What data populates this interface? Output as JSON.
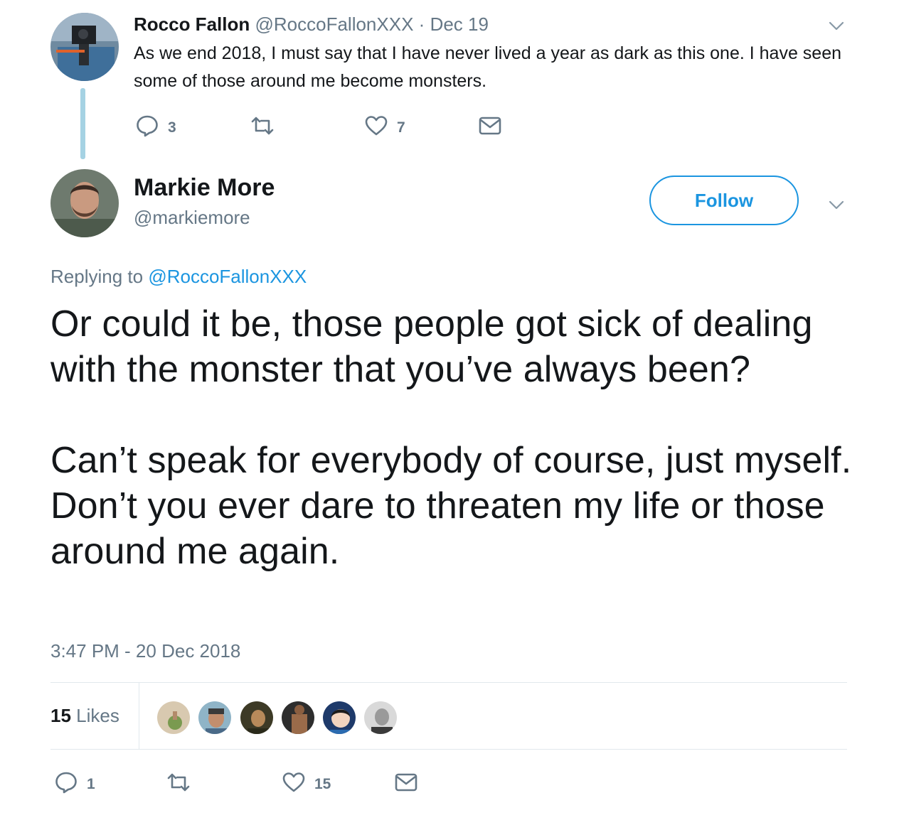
{
  "parent_tweet": {
    "name": "Rocco Fallon",
    "handle": "@RoccoFallonXXX",
    "separator": "·",
    "date": "Dec 19",
    "text": "As we end 2018, I must say that I have never lived a year as dark as this one. I have seen some of those around me become monsters.",
    "actions": {
      "reply_count": "3",
      "retweet_count": "",
      "like_count": "7"
    }
  },
  "main_tweet": {
    "name": "Markie More",
    "handle": "@markiemore",
    "follow_label": "Follow",
    "replying_prefix": "Replying to",
    "replying_to": "@RoccoFallonXXX",
    "text_paragraph_1": "Or could it be, those people got sick of dealing with the monster that you’ve always been?",
    "text_paragraph_2": "Can’t speak for everybody of course, just myself. Don’t you ever dare to threaten my life or those around me again.",
    "timestamp": "3:47 PM - 20 Dec 2018",
    "likes_number": "15",
    "likes_label": "Likes",
    "actions": {
      "reply_count": "1",
      "retweet_count": "",
      "like_count": "15"
    }
  },
  "colors": {
    "link_blue": "#1b95e0",
    "muted_gray": "#657786",
    "thread_line": "#a5d2e3",
    "divider": "#e1e8ed"
  },
  "icons": [
    "reply-icon",
    "retweet-icon",
    "like-icon",
    "dm-icon",
    "chevron-down-icon"
  ]
}
